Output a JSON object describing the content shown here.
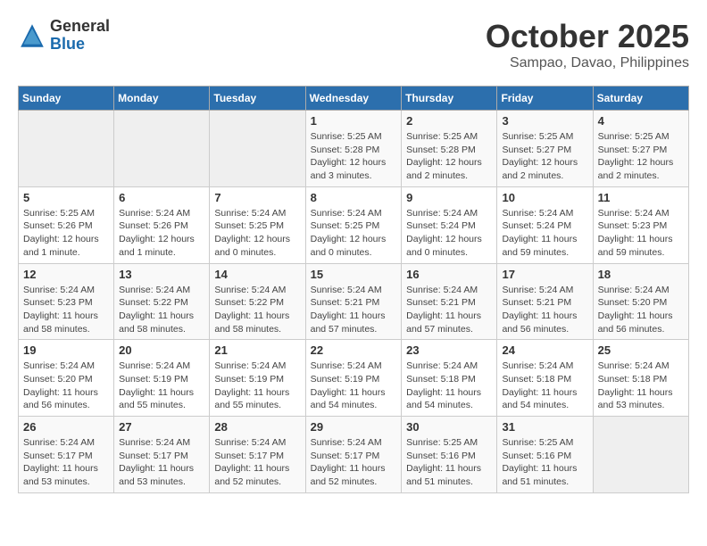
{
  "header": {
    "logo_general": "General",
    "logo_blue": "Blue",
    "month_title": "October 2025",
    "location": "Sampao, Davao, Philippines"
  },
  "weekdays": [
    "Sunday",
    "Monday",
    "Tuesday",
    "Wednesday",
    "Thursday",
    "Friday",
    "Saturday"
  ],
  "weeks": [
    [
      {
        "day": "",
        "info": ""
      },
      {
        "day": "",
        "info": ""
      },
      {
        "day": "",
        "info": ""
      },
      {
        "day": "1",
        "info": "Sunrise: 5:25 AM\nSunset: 5:28 PM\nDaylight: 12 hours and 3 minutes."
      },
      {
        "day": "2",
        "info": "Sunrise: 5:25 AM\nSunset: 5:28 PM\nDaylight: 12 hours and 2 minutes."
      },
      {
        "day": "3",
        "info": "Sunrise: 5:25 AM\nSunset: 5:27 PM\nDaylight: 12 hours and 2 minutes."
      },
      {
        "day": "4",
        "info": "Sunrise: 5:25 AM\nSunset: 5:27 PM\nDaylight: 12 hours and 2 minutes."
      }
    ],
    [
      {
        "day": "5",
        "info": "Sunrise: 5:25 AM\nSunset: 5:26 PM\nDaylight: 12 hours and 1 minute."
      },
      {
        "day": "6",
        "info": "Sunrise: 5:24 AM\nSunset: 5:26 PM\nDaylight: 12 hours and 1 minute."
      },
      {
        "day": "7",
        "info": "Sunrise: 5:24 AM\nSunset: 5:25 PM\nDaylight: 12 hours and 0 minutes."
      },
      {
        "day": "8",
        "info": "Sunrise: 5:24 AM\nSunset: 5:25 PM\nDaylight: 12 hours and 0 minutes."
      },
      {
        "day": "9",
        "info": "Sunrise: 5:24 AM\nSunset: 5:24 PM\nDaylight: 12 hours and 0 minutes."
      },
      {
        "day": "10",
        "info": "Sunrise: 5:24 AM\nSunset: 5:24 PM\nDaylight: 11 hours and 59 minutes."
      },
      {
        "day": "11",
        "info": "Sunrise: 5:24 AM\nSunset: 5:23 PM\nDaylight: 11 hours and 59 minutes."
      }
    ],
    [
      {
        "day": "12",
        "info": "Sunrise: 5:24 AM\nSunset: 5:23 PM\nDaylight: 11 hours and 58 minutes."
      },
      {
        "day": "13",
        "info": "Sunrise: 5:24 AM\nSunset: 5:22 PM\nDaylight: 11 hours and 58 minutes."
      },
      {
        "day": "14",
        "info": "Sunrise: 5:24 AM\nSunset: 5:22 PM\nDaylight: 11 hours and 58 minutes."
      },
      {
        "day": "15",
        "info": "Sunrise: 5:24 AM\nSunset: 5:21 PM\nDaylight: 11 hours and 57 minutes."
      },
      {
        "day": "16",
        "info": "Sunrise: 5:24 AM\nSunset: 5:21 PM\nDaylight: 11 hours and 57 minutes."
      },
      {
        "day": "17",
        "info": "Sunrise: 5:24 AM\nSunset: 5:21 PM\nDaylight: 11 hours and 56 minutes."
      },
      {
        "day": "18",
        "info": "Sunrise: 5:24 AM\nSunset: 5:20 PM\nDaylight: 11 hours and 56 minutes."
      }
    ],
    [
      {
        "day": "19",
        "info": "Sunrise: 5:24 AM\nSunset: 5:20 PM\nDaylight: 11 hours and 56 minutes."
      },
      {
        "day": "20",
        "info": "Sunrise: 5:24 AM\nSunset: 5:19 PM\nDaylight: 11 hours and 55 minutes."
      },
      {
        "day": "21",
        "info": "Sunrise: 5:24 AM\nSunset: 5:19 PM\nDaylight: 11 hours and 55 minutes."
      },
      {
        "day": "22",
        "info": "Sunrise: 5:24 AM\nSunset: 5:19 PM\nDaylight: 11 hours and 54 minutes."
      },
      {
        "day": "23",
        "info": "Sunrise: 5:24 AM\nSunset: 5:18 PM\nDaylight: 11 hours and 54 minutes."
      },
      {
        "day": "24",
        "info": "Sunrise: 5:24 AM\nSunset: 5:18 PM\nDaylight: 11 hours and 54 minutes."
      },
      {
        "day": "25",
        "info": "Sunrise: 5:24 AM\nSunset: 5:18 PM\nDaylight: 11 hours and 53 minutes."
      }
    ],
    [
      {
        "day": "26",
        "info": "Sunrise: 5:24 AM\nSunset: 5:17 PM\nDaylight: 11 hours and 53 minutes."
      },
      {
        "day": "27",
        "info": "Sunrise: 5:24 AM\nSunset: 5:17 PM\nDaylight: 11 hours and 53 minutes."
      },
      {
        "day": "28",
        "info": "Sunrise: 5:24 AM\nSunset: 5:17 PM\nDaylight: 11 hours and 52 minutes."
      },
      {
        "day": "29",
        "info": "Sunrise: 5:24 AM\nSunset: 5:17 PM\nDaylight: 11 hours and 52 minutes."
      },
      {
        "day": "30",
        "info": "Sunrise: 5:25 AM\nSunset: 5:16 PM\nDaylight: 11 hours and 51 minutes."
      },
      {
        "day": "31",
        "info": "Sunrise: 5:25 AM\nSunset: 5:16 PM\nDaylight: 11 hours and 51 minutes."
      },
      {
        "day": "",
        "info": ""
      }
    ]
  ]
}
